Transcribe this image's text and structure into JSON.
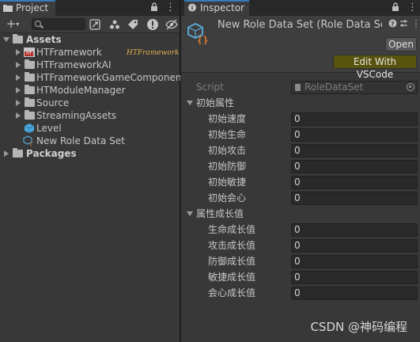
{
  "project": {
    "tab_label": "Project",
    "tree": [
      {
        "label": "Assets",
        "type": "root-open",
        "bold": true
      },
      {
        "label": "HTFramework",
        "type": "folder-ht",
        "badge": "HT",
        "logo": "HTFramework"
      },
      {
        "label": "HTFrameworkAI",
        "type": "folder"
      },
      {
        "label": "HTFrameworkGameComponent",
        "type": "folder"
      },
      {
        "label": "HTModuleManager",
        "type": "folder"
      },
      {
        "label": "Source",
        "type": "folder"
      },
      {
        "label": "StreamingAssets",
        "type": "folder"
      },
      {
        "label": "Level",
        "type": "scene"
      },
      {
        "label": "New Role Data Set",
        "type": "asset"
      },
      {
        "label": "Packages",
        "type": "root-closed",
        "bold": true
      }
    ]
  },
  "inspector": {
    "tab_label": "Inspector",
    "title": "New Role Data Set (Role Data Se",
    "open_button": "Open",
    "vscode_button": "Edit With VSCode",
    "script_label": "Script",
    "script_value": "RoleDataSet",
    "groups": [
      {
        "label": "初始属性",
        "fields": [
          {
            "label": "初始速度",
            "value": "0"
          },
          {
            "label": "初始生命",
            "value": "0"
          },
          {
            "label": "初始攻击",
            "value": "0"
          },
          {
            "label": "初始防御",
            "value": "0"
          },
          {
            "label": "初始敏捷",
            "value": "0"
          },
          {
            "label": "初始会心",
            "value": "0"
          }
        ]
      },
      {
        "label": "属性成长值",
        "fields": [
          {
            "label": "生命成长值",
            "value": "0"
          },
          {
            "label": "攻击成长值",
            "value": "0"
          },
          {
            "label": "防御成长值",
            "value": "0"
          },
          {
            "label": "敏捷成长值",
            "value": "0"
          },
          {
            "label": "会心成长值",
            "value": "0"
          }
        ]
      }
    ]
  },
  "watermark": "CSDN @神码编程",
  "colors": {
    "accent": "#3a79bb",
    "vscode_button": "#58540f",
    "asset_cube": "#3da9e0"
  }
}
